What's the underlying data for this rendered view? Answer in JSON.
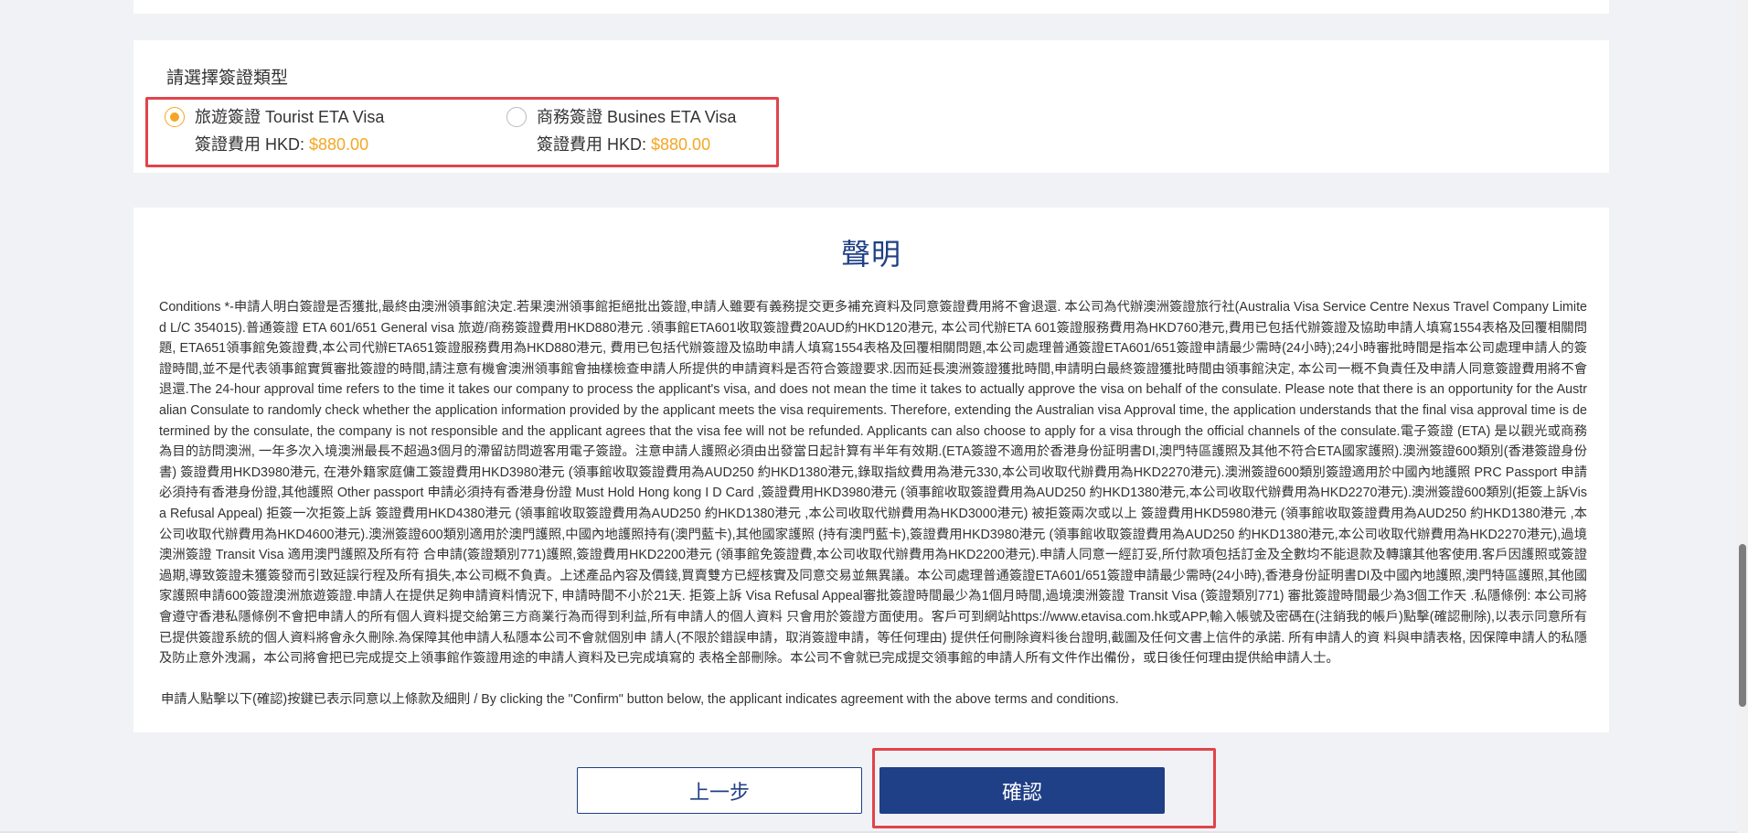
{
  "visa_section": {
    "label": "請選擇簽證類型",
    "options": [
      {
        "title": "旅遊簽證 Tourist ETA Visa",
        "fee_label": "簽證費用 HKD: ",
        "fee_value": "$880.00",
        "selected": true
      },
      {
        "title": "商務簽證 Busines ETA Visa",
        "fee_label": "簽證費用 HKD: ",
        "fee_value": "$880.00",
        "selected": false
      }
    ]
  },
  "terms": {
    "title": "聲明",
    "body": "Conditions *-申請人明白簽證是否獲批,最終由澳洲領事館決定.若果澳洲領事館拒絕批出簽證,申請人雖要有義務提交更多補充資料及同意簽證費用將不會退還. 本公司為代辦澳洲簽證旅行社(Australia Visa Service Centre Nexus Travel Company Limited L/C 354015).普通簽證 ETA 601/651 General visa 旅遊/商務簽證費用HKD880港元 .領事館ETA601收取簽證費20AUD約HKD120港元, 本公司代辦ETA 601簽證服務費用為HKD760港元,費用已包括代辦簽證及協助申請人填寫1554表格及回覆相關問題, ETA651領事館免簽證費,本公司代辦ETA651簽證服務費用為HKD880港元, 費用已包括代辦簽證及協助申請人填寫1554表格及回覆相關問題,本公司處理普通簽證ETA601/651簽證申請最少需時(24小時);24小時審批時間是指本公司處理申請人的簽證時間,並不是代表領事館實質審批簽證的時間,請注意有機會澳洲領事館會抽樣檢查申請人所提供的申請資料是否符合簽證要求.因而延長澳洲簽證獲批時間,申請明白最終簽證獲批時間由領事館決定, 本公司一概不負責任及申請人同意簽證費用將不會退還.The 24-hour approval time refers to the time it takes our company to process the applicant's visa, and does not mean the time it takes to actually approve the visa on behalf of the consulate. Please note that there is an opportunity for the Australian Consulate to randomly check whether the application information provided by the applicant meets the visa requirements. Therefore, extending the Australian visa Approval time, the application understands that the final visa approval time is determined by the consulate, the company is not responsible and the applicant agrees that the visa fee will not be refunded. Applicants can also choose to apply for a visa through the official channels of the consulate.電子簽證 (ETA) 是以觀光或商務為目的訪問澳洲, 一年多次入境澳洲最長不超過3個月的滯留訪問遊客用電子簽證。注意申請人護照必須由出發當日起計算有半年有效期.(ETA簽證不適用於香港身份証明書DI,澳門特區護照及其他不符合ETA國家護照).澳洲簽證600類別(香港簽證身份書) 簽證費用HKD3980港元, 在港外籍家庭傭工簽證費用HKD3980港元 (領事館收取簽證費用為AUD250 約HKD1380港元,錄取指紋費用為港元330,本公司收取代辦費用為HKD2270港元).澳洲簽證600類別簽證適用於中國內地護照 PRC Passport 申請必須持有香港身份證,其他護照 Other passport 申請必須持有香港身份證 Must Hold Hong kong I D Card ,簽證費用HKD3980港元 (領事館收取簽證費用為AUD250 約HKD1380港元,本公司收取代辦費用為HKD2270港元).澳洲簽證600類別(拒簽上訴Visa Refusal Appeal) 拒簽一次拒簽上訴 簽證費用HKD4380港元 (領事館收取簽證費用為AUD250 約HKD1380港元 ,本公司收取代辦費用為HKD3000港元) 被拒簽兩次或以上 簽證費用HKD5980港元 (領事館收取簽證費用為AUD250 約HKD1380港元 ,本公司收取代辦費用為HKD4600港元).澳洲簽證600類別適用於澳門護照,中國內地護照持有(澳門藍卡),其他國家護照 (持有澳門藍卡),簽證費用HKD3980港元 (領事館收取簽證費用為AUD250 約HKD1380港元,本公司收取代辦費用為HKD2270港元),過境澳洲簽證 Transit Visa 適用澳門護照及所有符 合申請(簽證類別771)護照,簽證費用HKD2200港元 (領事館免簽證費,本公司收取代辦費用為HKD2200港元).申請人同意一經訂妥,所付款項包括訂金及全數均不能退款及轉讓其他客使用.客戶因護照或簽證過期,導致簽證未獲簽發而引致延誤行程及所有損失,本公司概不負責。上述產品內容及價錢,買賣雙方已經核實及同意交易並無異議。本公司處理普通簽證ETA601/651簽證申請最少需時(24小時),香港身份証明書DI及中國內地護照,澳門特區護照,其他國家護照申請600簽證澳洲旅遊簽證.申請人在提供足夠申請資料情況下, 申請時間不小於21天. 拒簽上訴 Visa Refusal Appeal審批簽證時間最少為1個月時間,過境澳洲簽證 Transit Visa (簽證類別771) 審批簽證時間最少為3個工作天 .私隱條例: 本公司將會遵守香港私隱條例不會把申請人的所有個人資料提交給第三方商業行為而得到利益,所有申請人的個人資料 只會用於簽證方面使用。客戶可到網站https://www.etavisa.com.hk或APP,輸入帳號及密碼在(注銷我的帳戶)點擊(確認刪除),以表示同意所有已提供簽證系統的個人資料將會永久刪除.為保障其他申請人私隱本公司不會就個別申 請人(不限於錯誤申請，取消簽證申請，等任何理由) 提供任何刪除資料後台證明,截圖及任何文書上信件的承諾. 所有申請人的資 料與申請表格, 因保障申請人的私隱及防止意外洩漏，本公司將會把已完成提交上領事館作簽證用途的申請人資料及已完成填寫的 表格全部刪除。本公司不會就已完成提交領事館的申請人所有文件作出備份，或日後任何理由提供給申請人士。",
    "agree": "申請人點擊以下(確認)按鍵已表示同意以上條款及細則 / By clicking the \"Confirm\" button below, the applicant indicates agreement with the above terms and conditions."
  },
  "buttons": {
    "prev": "上一步",
    "confirm": "確認"
  },
  "colors": {
    "accent": "#f5a623",
    "primary": "#1f3f86",
    "highlight": "#e0444b"
  }
}
